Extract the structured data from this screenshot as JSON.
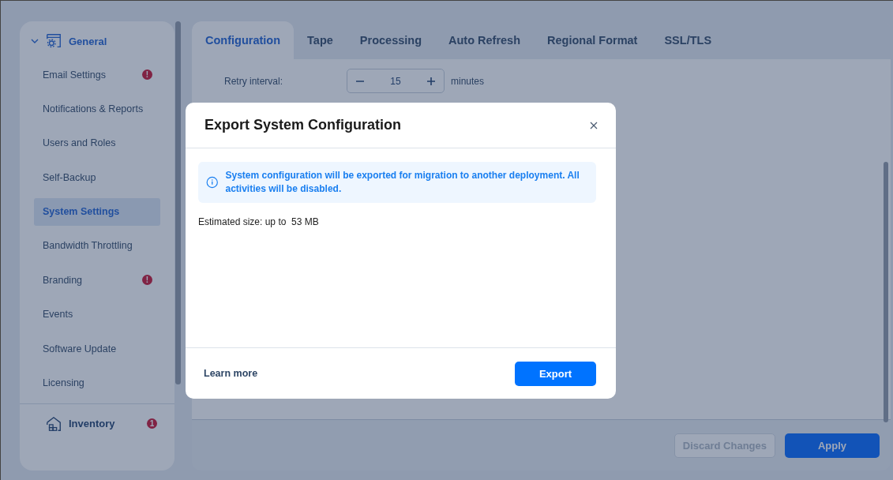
{
  "sidebar": {
    "groups": [
      {
        "kind": "general",
        "label": "General",
        "expanded": true,
        "items": [
          {
            "label": "Email Settings",
            "selected": false,
            "badge": "!"
          },
          {
            "label": "Notifications & Reports",
            "selected": false
          },
          {
            "label": "Users and Roles",
            "selected": false
          },
          {
            "label": "Self-Backup",
            "selected": false
          },
          {
            "label": "System Settings",
            "selected": true
          },
          {
            "label": "Bandwidth Throttling",
            "selected": false
          },
          {
            "label": "Branding",
            "selected": false,
            "badge": "!"
          },
          {
            "label": "Events",
            "selected": false
          },
          {
            "label": "Software Update",
            "selected": false
          },
          {
            "label": "Licensing",
            "selected": false
          }
        ]
      },
      {
        "kind": "inventory",
        "label": "Inventory",
        "badge": "1"
      }
    ]
  },
  "tabs": [
    {
      "label": "Configuration",
      "selected": true
    },
    {
      "label": "Tape",
      "selected": false
    },
    {
      "label": "Processing",
      "selected": false
    },
    {
      "label": "Auto Refresh",
      "selected": false
    },
    {
      "label": "Regional Format",
      "selected": false
    },
    {
      "label": "SSL/TLS",
      "selected": false
    }
  ],
  "retry": {
    "label": "Retry interval:",
    "value": "15",
    "unit": "minutes"
  },
  "footer": {
    "discard": {
      "label": "Discard Changes",
      "disabled": true
    },
    "apply": {
      "label": "Apply"
    }
  },
  "dialog": {
    "title": "Export System Configuration",
    "info": "System configuration will be exported for migration to another deployment. All activities will be disabled.",
    "estimate": "Estimated size: up to  53 MB",
    "link": "Learn more",
    "button": "Export"
  }
}
